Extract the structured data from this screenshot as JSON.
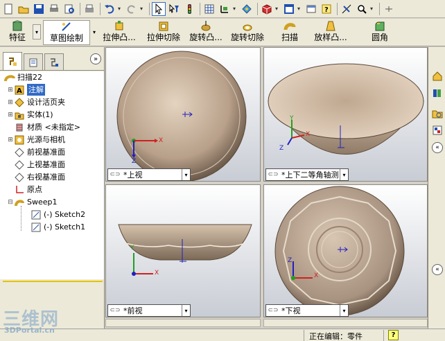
{
  "toolbar_icons": [
    "new-icon",
    "open-icon",
    "save-icon",
    "print-icon",
    "print-preview-icon",
    "undo-icon",
    "redo-icon",
    "select-icon",
    "select-filter-icon",
    "rebuild-icon",
    "options-icon",
    "coordinate-icon",
    "view-orientation-icon",
    "display-style-icon",
    "view-icon",
    "help-icon",
    "zoom-icon"
  ],
  "features": {
    "feature_tab": "特征",
    "sketch_tab": "草图绘制",
    "extrude_boss": "拉伸凸...",
    "extrude_cut": "拉伸切除",
    "revolve_boss": "旋转凸...",
    "revolve_cut": "旋转切除",
    "sweep": "扫描",
    "loft_boss": "放样凸...",
    "fillet": "圆角"
  },
  "tree": {
    "root": "扫描22",
    "items": [
      {
        "label": "注解",
        "icon": "annotations-icon",
        "expandable": true,
        "selected": true
      },
      {
        "label": "设计活页夹",
        "icon": "design-binder-icon",
        "expandable": true
      },
      {
        "label": "实体(1)",
        "icon": "solid-bodies-icon",
        "expandable": true
      },
      {
        "label": "材质 <未指定>",
        "icon": "material-icon",
        "expandable": false
      },
      {
        "label": "光源与相机",
        "icon": "lights-cameras-icon",
        "expandable": true
      },
      {
        "label": "前视基准面",
        "icon": "plane-icon",
        "expandable": false
      },
      {
        "label": "上视基准面",
        "icon": "plane-icon",
        "expandable": false
      },
      {
        "label": "右视基准面",
        "icon": "plane-icon",
        "expandable": false
      },
      {
        "label": "原点",
        "icon": "origin-icon",
        "expandable": false
      },
      {
        "label": "Sweep1",
        "icon": "sweep-icon",
        "expandable": true,
        "expanded": true
      },
      {
        "label": "(-) Sketch2",
        "icon": "sketch-icon",
        "child": true
      },
      {
        "label": "(-) Sketch1",
        "icon": "sketch-icon",
        "child": true
      }
    ]
  },
  "viewports": {
    "top_left": "*上视",
    "top_right": "*上下二等角轴测",
    "bottom_left": "*前视",
    "bottom_right": "*下视"
  },
  "axes": {
    "x": "X",
    "y": "Y",
    "z": "Z"
  },
  "status": {
    "editing": "正在编辑：零件",
    "help": "?"
  },
  "watermark": {
    "big": "三维网",
    "small": "3DPortal.cn"
  },
  "colors": {
    "selected": "#316ac5",
    "rollback": "#e5c300",
    "bowl": "#b5a08c",
    "axis_x": "#d02020",
    "axis_y": "#20a020",
    "axis_z": "#2020c0"
  }
}
